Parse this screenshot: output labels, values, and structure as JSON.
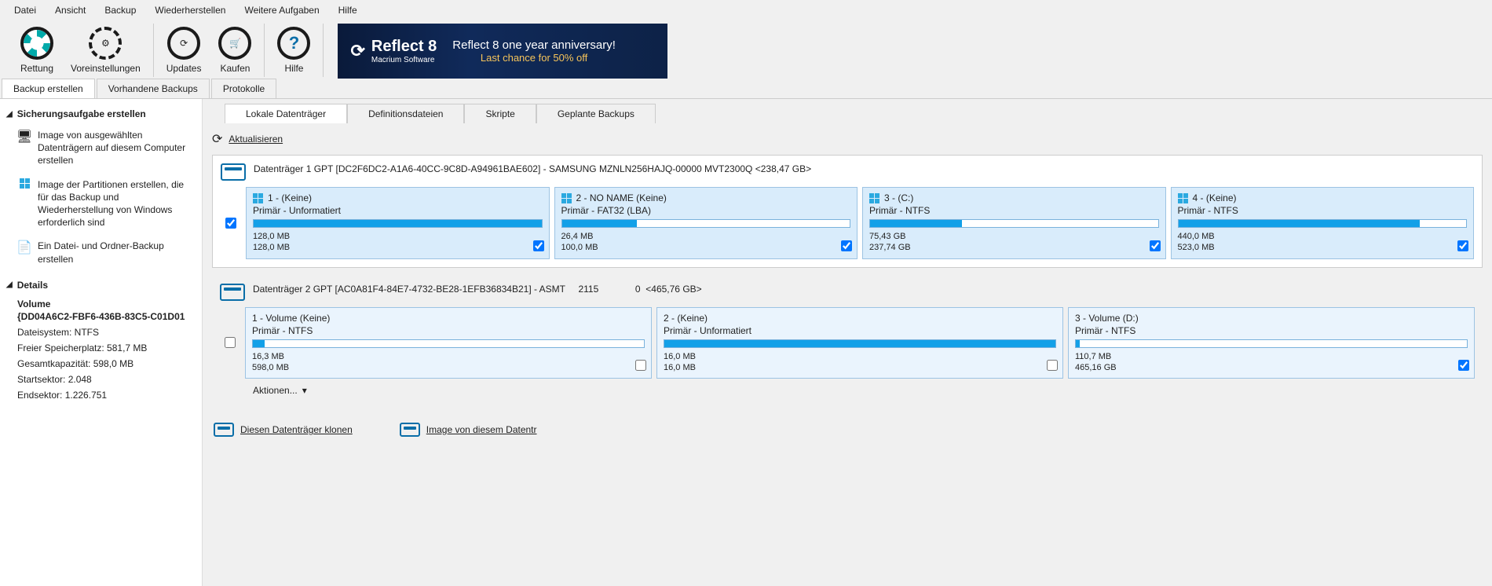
{
  "menu": [
    "Datei",
    "Ansicht",
    "Backup",
    "Wiederherstellen",
    "Weitere Aufgaben",
    "Hilfe"
  ],
  "toolbar": {
    "rescue": "Rettung",
    "prefs": "Voreinstellungen",
    "updates": "Updates",
    "buy": "Kaufen",
    "help": "Hilfe"
  },
  "banner": {
    "product": "Reflect 8",
    "subtitle": "Macrium Software",
    "line1": "Reflect 8 one year anniversary!",
    "line2": "Last chance for 50% off"
  },
  "tabs_main": {
    "create": "Backup erstellen",
    "existing": "Vorhandene Backups",
    "logs": "Protokolle"
  },
  "sidebar": {
    "section_create": "Sicherungsaufgabe erstellen",
    "item_image": "Image von ausgewählten Datenträgern auf diesem Computer erstellen",
    "item_partitions": "Image der Partitionen erstellen, die für das Backup und Wiederherstellung von Windows erforderlich sind",
    "item_files": "Ein Datei- und Ordner-Backup erstellen",
    "section_details": "Details",
    "details": {
      "volname1": "Volume",
      "volname2": "{DD04A6C2-FBF6-436B-83C5-C01D01",
      "fs": "Dateisystem: NTFS",
      "free": "Freier Speicherplatz: 581,7 MB",
      "cap": "Gesamtkapazität: 598,0 MB",
      "start": "Startsektor: 2.048",
      "end": "Endsektor: 1.226.751"
    }
  },
  "inner_tabs": {
    "local": "Lokale Datenträger",
    "def": "Definitionsdateien",
    "scripts": "Skripte",
    "sched": "Geplante Backups"
  },
  "refresh": "Aktualisieren",
  "disk1": {
    "title": "Datenträger 1 GPT [DC2F6DC2-A1A6-40CC-9C8D-A94961BAE602] - SAMSUNG MZNLN256HAJQ-00000 MVT2300Q  <238,47 GB>",
    "parts": [
      {
        "name": "1 -  (Keine)",
        "sub": "Primär - Unformatiert",
        "size1": "128,0 MB",
        "size2": "128,0 MB",
        "fill": 100,
        "win": true,
        "checked": true
      },
      {
        "name": "2 - NO NAME (Keine)",
        "sub": "Primär - FAT32 (LBA)",
        "size1": "26,4 MB",
        "size2": "100,0 MB",
        "fill": 26,
        "win": true,
        "checked": true
      },
      {
        "name": "3 -  (C:)",
        "sub": "Primär - NTFS",
        "size1": "75,43 GB",
        "size2": "237,74 GB",
        "fill": 32,
        "win": true,
        "checked": true
      },
      {
        "name": "4 -  (Keine)",
        "sub": "Primär - NTFS",
        "size1": "440,0 MB",
        "size2": "523,0 MB",
        "fill": 84,
        "win": true,
        "checked": true
      }
    ]
  },
  "disk2": {
    "title": "Datenträger 2 GPT [AC0A81F4-84E7-4732-BE28-1EFB36834B21] - ASMT     2115              0  <465,76 GB>",
    "parts": [
      {
        "name": "1 - Volume (Keine)",
        "sub": "Primär - NTFS",
        "size1": "16,3 MB",
        "size2": "598,0 MB",
        "fill": 3,
        "win": false,
        "checked": false
      },
      {
        "name": "2 -  (Keine)",
        "sub": "Primär - Unformatiert",
        "size1": "16,0 MB",
        "size2": "16,0 MB",
        "fill": 100,
        "win": false,
        "checked": false
      },
      {
        "name": "3 - Volume (D:)",
        "sub": "Primär - NTFS",
        "size1": "110,7 MB",
        "size2": "465,16 GB",
        "fill": 1,
        "win": false,
        "checked": true
      }
    ],
    "actions": "Aktionen..."
  },
  "bottom": {
    "clone": "Diesen Datenträger klonen",
    "image": "Image von diesem Datentr"
  }
}
